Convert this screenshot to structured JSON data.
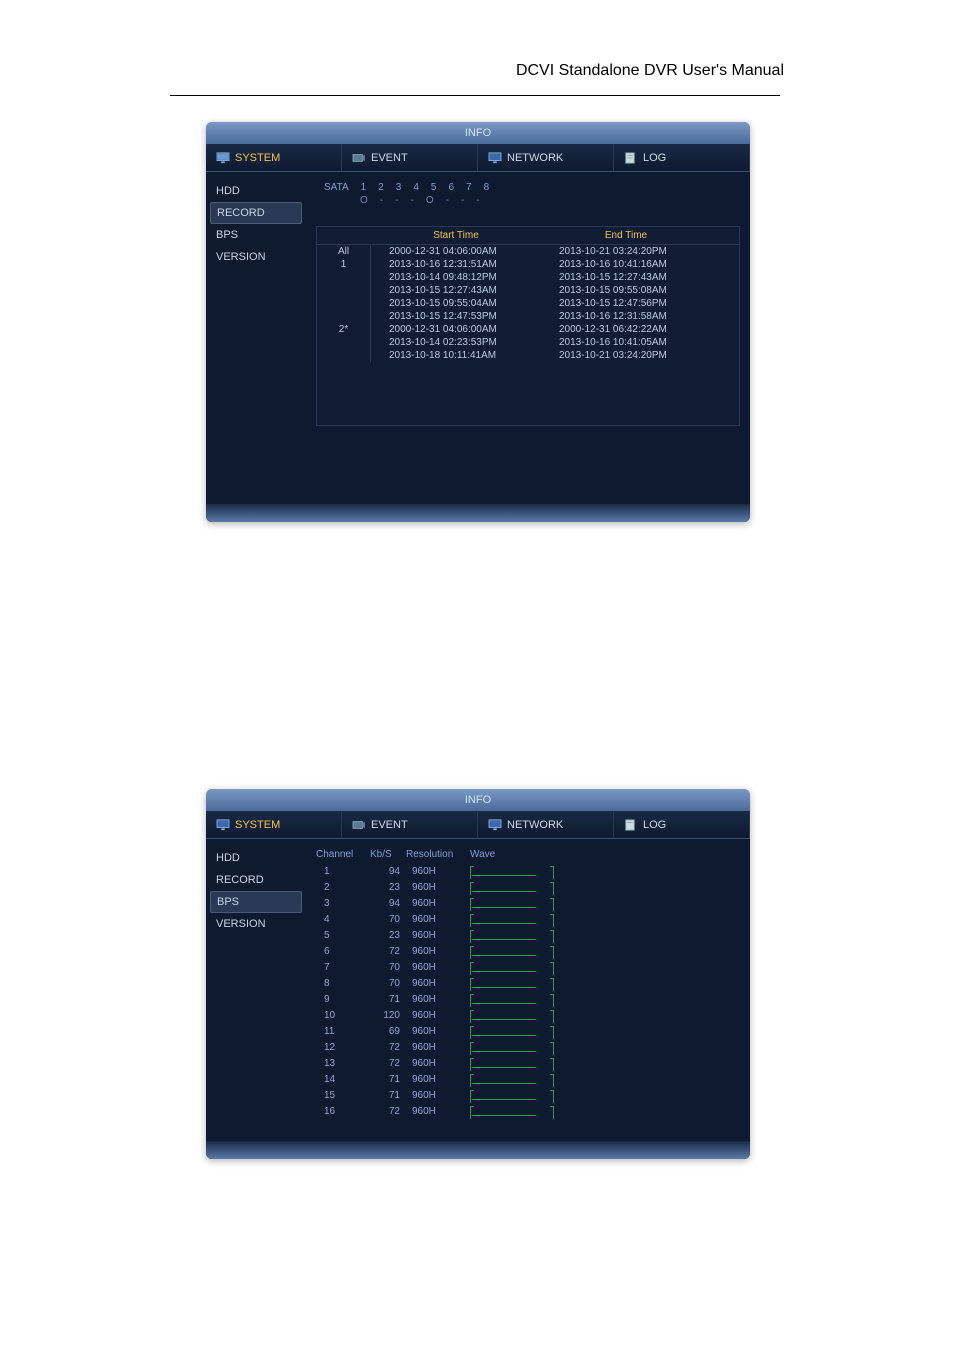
{
  "page_title": "DCVI Standalone DVR User's Manual",
  "window_title": "INFO",
  "tabs": [
    {
      "label": "SYSTEM",
      "icon": "monitor-icon",
      "active": true
    },
    {
      "label": "EVENT",
      "icon": "camera-icon",
      "active": false
    },
    {
      "label": "NETWORK",
      "icon": "monitor-icon",
      "active": false
    },
    {
      "label": "LOG",
      "icon": "page-icon",
      "active": false
    }
  ],
  "sidebar": {
    "items": [
      "HDD",
      "RECORD",
      "BPS",
      "VERSION"
    ]
  },
  "record_view": {
    "sata_label": "SATA",
    "sata_ports": [
      "1",
      "2",
      "3",
      "4",
      "5",
      "6",
      "7",
      "8"
    ],
    "sata_status": [
      "O",
      "-",
      "-",
      "-",
      "O",
      "-",
      "-",
      "-"
    ],
    "table": {
      "headers": {
        "name": "",
        "start": "Start Time",
        "end": "End Time"
      },
      "rows": [
        {
          "name": "All",
          "start": "2000-12-31 04:06:00AM",
          "end": "2013-10-21 03:24:20PM"
        },
        {
          "name": "1",
          "start": "2013-10-16 12:31:51AM",
          "end": "2013-10-16 10:41:16AM"
        },
        {
          "name": "",
          "start": "2013-10-14 09:48:12PM",
          "end": "2013-10-15 12:27:43AM"
        },
        {
          "name": "",
          "start": "2013-10-15 12:27:43AM",
          "end": "2013-10-15 09:55:08AM"
        },
        {
          "name": "",
          "start": "2013-10-15 09:55:04AM",
          "end": "2013-10-15 12:47:56PM"
        },
        {
          "name": "",
          "start": "2013-10-15 12:47:53PM",
          "end": "2013-10-16 12:31:58AM"
        },
        {
          "name": "2*",
          "start": "2000-12-31 04:06:00AM",
          "end": "2000-12-31 06:42:22AM"
        },
        {
          "name": "",
          "start": "2013-10-14 02:23:53PM",
          "end": "2013-10-16 10:41:05AM"
        },
        {
          "name": "",
          "start": "2013-10-18 10:11:41AM",
          "end": "2013-10-21 03:24:20PM"
        }
      ]
    }
  },
  "bps_view": {
    "headers": {
      "c1": "Channel",
      "c2": "Kb/S",
      "c3": "Resolution",
      "c4": "Wave"
    },
    "rows": [
      {
        "ch": "1",
        "kbs": "94",
        "res": "960H"
      },
      {
        "ch": "2",
        "kbs": "23",
        "res": "960H"
      },
      {
        "ch": "3",
        "kbs": "94",
        "res": "960H"
      },
      {
        "ch": "4",
        "kbs": "70",
        "res": "960H"
      },
      {
        "ch": "5",
        "kbs": "23",
        "res": "960H"
      },
      {
        "ch": "6",
        "kbs": "72",
        "res": "960H"
      },
      {
        "ch": "7",
        "kbs": "70",
        "res": "960H"
      },
      {
        "ch": "8",
        "kbs": "70",
        "res": "960H"
      },
      {
        "ch": "9",
        "kbs": "71",
        "res": "960H"
      },
      {
        "ch": "10",
        "kbs": "120",
        "res": "960H"
      },
      {
        "ch": "11",
        "kbs": "69",
        "res": "960H"
      },
      {
        "ch": "12",
        "kbs": "72",
        "res": "960H"
      },
      {
        "ch": "13",
        "kbs": "72",
        "res": "960H"
      },
      {
        "ch": "14",
        "kbs": "71",
        "res": "960H"
      },
      {
        "ch": "15",
        "kbs": "71",
        "res": "960H"
      },
      {
        "ch": "16",
        "kbs": "72",
        "res": "960H"
      }
    ]
  }
}
